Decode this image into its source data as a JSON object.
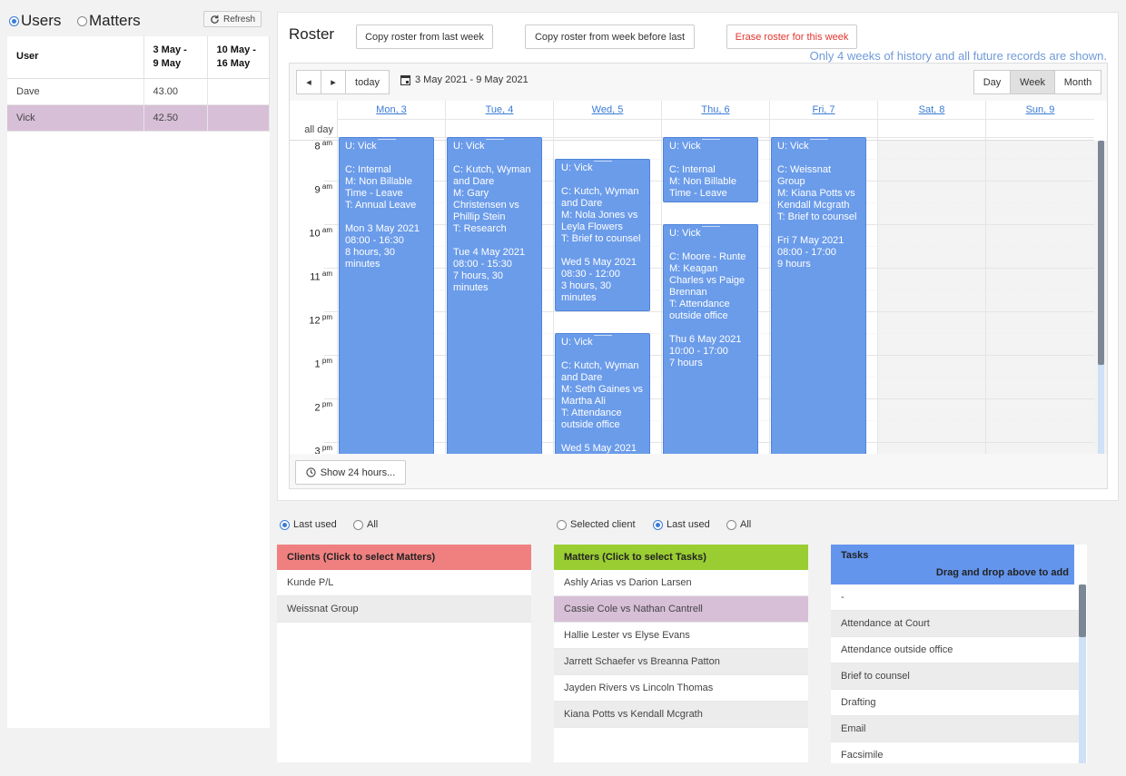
{
  "mode": {
    "users_label": "Users",
    "matters_label": "Matters",
    "selected": "users",
    "refresh_label": "Refresh"
  },
  "user_table": {
    "headers": [
      "User",
      "3 May -\n9 May",
      "10 May -\n16 May"
    ],
    "rows": [
      {
        "user": "Dave",
        "week1": "43.00",
        "week2": "",
        "selected": false
      },
      {
        "user": "Vick",
        "week1": "42.50",
        "week2": "",
        "selected": true
      }
    ]
  },
  "roster": {
    "title": "Roster",
    "copy_last_week": "Copy roster from last week",
    "copy_week_before_last": "Copy roster from week before last",
    "erase": "Erase roster for this week",
    "history_note": "Only 4 weeks of history and all future records are shown."
  },
  "calendar": {
    "prev": "◂",
    "next": "▸",
    "today": "today",
    "range": "3 May 2021 - 9 May 2021",
    "views": [
      "Day",
      "Week",
      "Month"
    ],
    "active_view": "Week",
    "days": [
      "Mon, 3",
      "Tue, 4",
      "Wed, 5",
      "Thu, 6",
      "Fri, 7",
      "Sat, 8",
      "Sun, 9"
    ],
    "allday_label": "all day",
    "hours": [
      {
        "h": "8",
        "ap": "am"
      },
      {
        "h": "9",
        "ap": "am"
      },
      {
        "h": "10",
        "ap": "am"
      },
      {
        "h": "11",
        "ap": "am"
      },
      {
        "h": "12",
        "ap": "pm"
      },
      {
        "h": "1",
        "ap": "pm"
      },
      {
        "h": "2",
        "ap": "pm"
      },
      {
        "h": "3",
        "ap": "pm"
      }
    ],
    "events": [
      {
        "day": 0,
        "start": 8.0,
        "end": 16.5,
        "user": "U: Vick",
        "lines": [
          "C: Internal",
          "M: Non Billable Time - Leave",
          "T: Annual Leave"
        ],
        "when": [
          "Mon 3 May 2021",
          "08:00 - 16:30",
          "8 hours, 30 minutes"
        ]
      },
      {
        "day": 1,
        "start": 8.0,
        "end": 15.5,
        "user": "U: Vick",
        "lines": [
          "C: Kutch, Wyman and Dare",
          "M: Gary Christensen vs Phillip Stein",
          "T: Research"
        ],
        "when": [
          "Tue 4 May 2021",
          "08:00 - 15:30",
          "7 hours, 30 minutes"
        ]
      },
      {
        "day": 2,
        "start": 8.5,
        "end": 12.0,
        "user": "U: Vick",
        "lines": [
          "C: Kutch, Wyman and Dare",
          "M: Nola Jones vs Leyla Flowers",
          "T: Brief to counsel"
        ],
        "when": [
          "Wed 5 May 2021",
          "08:30 - 12:00",
          "3 hours, 30 minutes"
        ]
      },
      {
        "day": 2,
        "start": 12.5,
        "end": 17.0,
        "user": "U: Vick",
        "lines": [
          "C: Kutch, Wyman and Dare",
          "M: Seth Gaines vs Martha Ali",
          "T: Attendance outside office"
        ],
        "when": [
          "Wed 5 May 2021"
        ]
      },
      {
        "day": 3,
        "start": 8.0,
        "end": 9.5,
        "user": "U: Vick",
        "lines": [
          "C: Internal",
          "M: Non Billable Time - Leave"
        ],
        "when": []
      },
      {
        "day": 3,
        "start": 10.0,
        "end": 17.0,
        "user": "U: Vick",
        "lines": [
          "C: Moore - Runte",
          "M: Keagan Charles vs Paige Brennan",
          "T: Attendance outside office"
        ],
        "when": [
          "Thu 6 May 2021",
          "10:00 - 17:00",
          "7 hours"
        ]
      },
      {
        "day": 4,
        "start": 8.0,
        "end": 17.0,
        "user": "U: Vick",
        "lines": [
          "C: Weissnat Group",
          "M: Kiana Potts vs Kendall Mcgrath",
          "T: Brief to counsel"
        ],
        "when": [
          "Fri 7 May 2021",
          "08:00 - 17:00",
          "9 hours"
        ]
      }
    ],
    "show24": "Show 24 hours..."
  },
  "client_filter": {
    "last_used": "Last used",
    "all": "All",
    "selected": "last_used"
  },
  "matter_filter": {
    "selected_client": "Selected client",
    "last_used": "Last used",
    "all": "All",
    "selected": "last_used"
  },
  "clients": {
    "header": "Clients (Click to select Matters)",
    "header_color": "#f08080",
    "items": [
      "Kunde P/L",
      "Weissnat Group"
    ]
  },
  "matters": {
    "header": "Matters (Click to select Tasks)",
    "header_color": "#9acd32",
    "items": [
      "Ashly Arias vs Darion Larsen",
      "Cassie Cole vs Nathan Cantrell",
      "Hallie Lester vs Elyse Evans",
      "Jarrett Schaefer vs Breanna Patton",
      "Jayden Rivers vs Lincoln Thomas",
      "Kiana Potts vs Kendall Mcgrath"
    ],
    "selected_index": 1
  },
  "tasks": {
    "header": "Tasks",
    "subheader": "Drag and drop above to add",
    "header_color": "#6495ed",
    "items": [
      "-",
      "Attendance at Court",
      "Attendance outside office",
      "Brief to counsel",
      "Drafting",
      "Email",
      "Facsimile"
    ]
  }
}
